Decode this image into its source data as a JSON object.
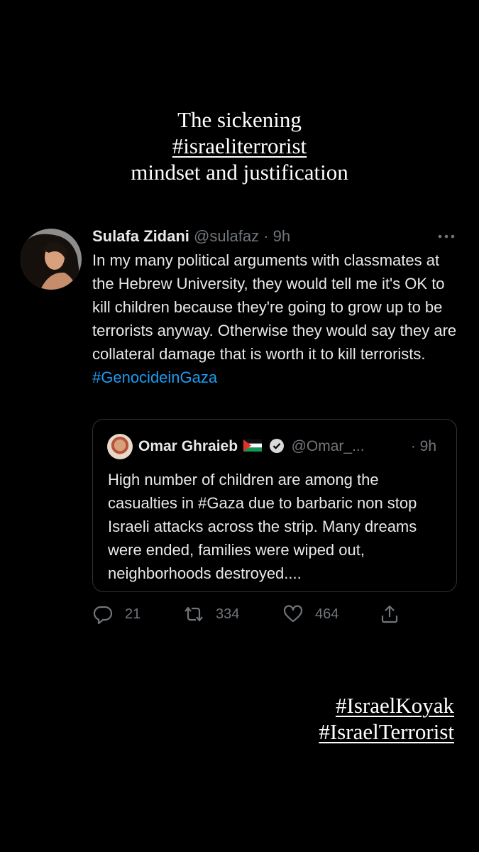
{
  "caption": {
    "line1": "The sickening",
    "line2": "#israeliterrorist",
    "line3": "mindset and justification"
  },
  "tweet": {
    "author_name": "Sulafa Zidani",
    "handle": "@sulafaz",
    "separator": "·",
    "time": "9h",
    "more_icon": "more-horizontal-icon",
    "body_text": "In my many political arguments with classmates at the Hebrew University, they would tell me it's OK to kill children because they're going to grow up to be terrorists anyway. Otherwise they would say they are collateral damage that is worth it to kill terrorists.",
    "hashtag": "#GenocideinGaza"
  },
  "quote": {
    "author_name": "Omar Ghraieb",
    "flag_icon": "palestine-flag-icon",
    "verified_icon": "verified-badge-icon",
    "handle": "@Omar_...",
    "time": "· 9h",
    "body_text": "High number of children are among the casualties in #Gaza due to barbaric non stop Israeli attacks across the strip. Many dreams were ended, families were wiped out, neighborhoods destroyed...."
  },
  "actions": {
    "reply_count": "21",
    "retweet_count": "334",
    "like_count": "464"
  },
  "story_hashtags": [
    "#IsraelKoyak",
    "#IsraelTerrorist"
  ],
  "colors": {
    "background": "#000000",
    "link": "#1d9bf0",
    "muted": "#71767b",
    "text": "#e7e9ea"
  }
}
